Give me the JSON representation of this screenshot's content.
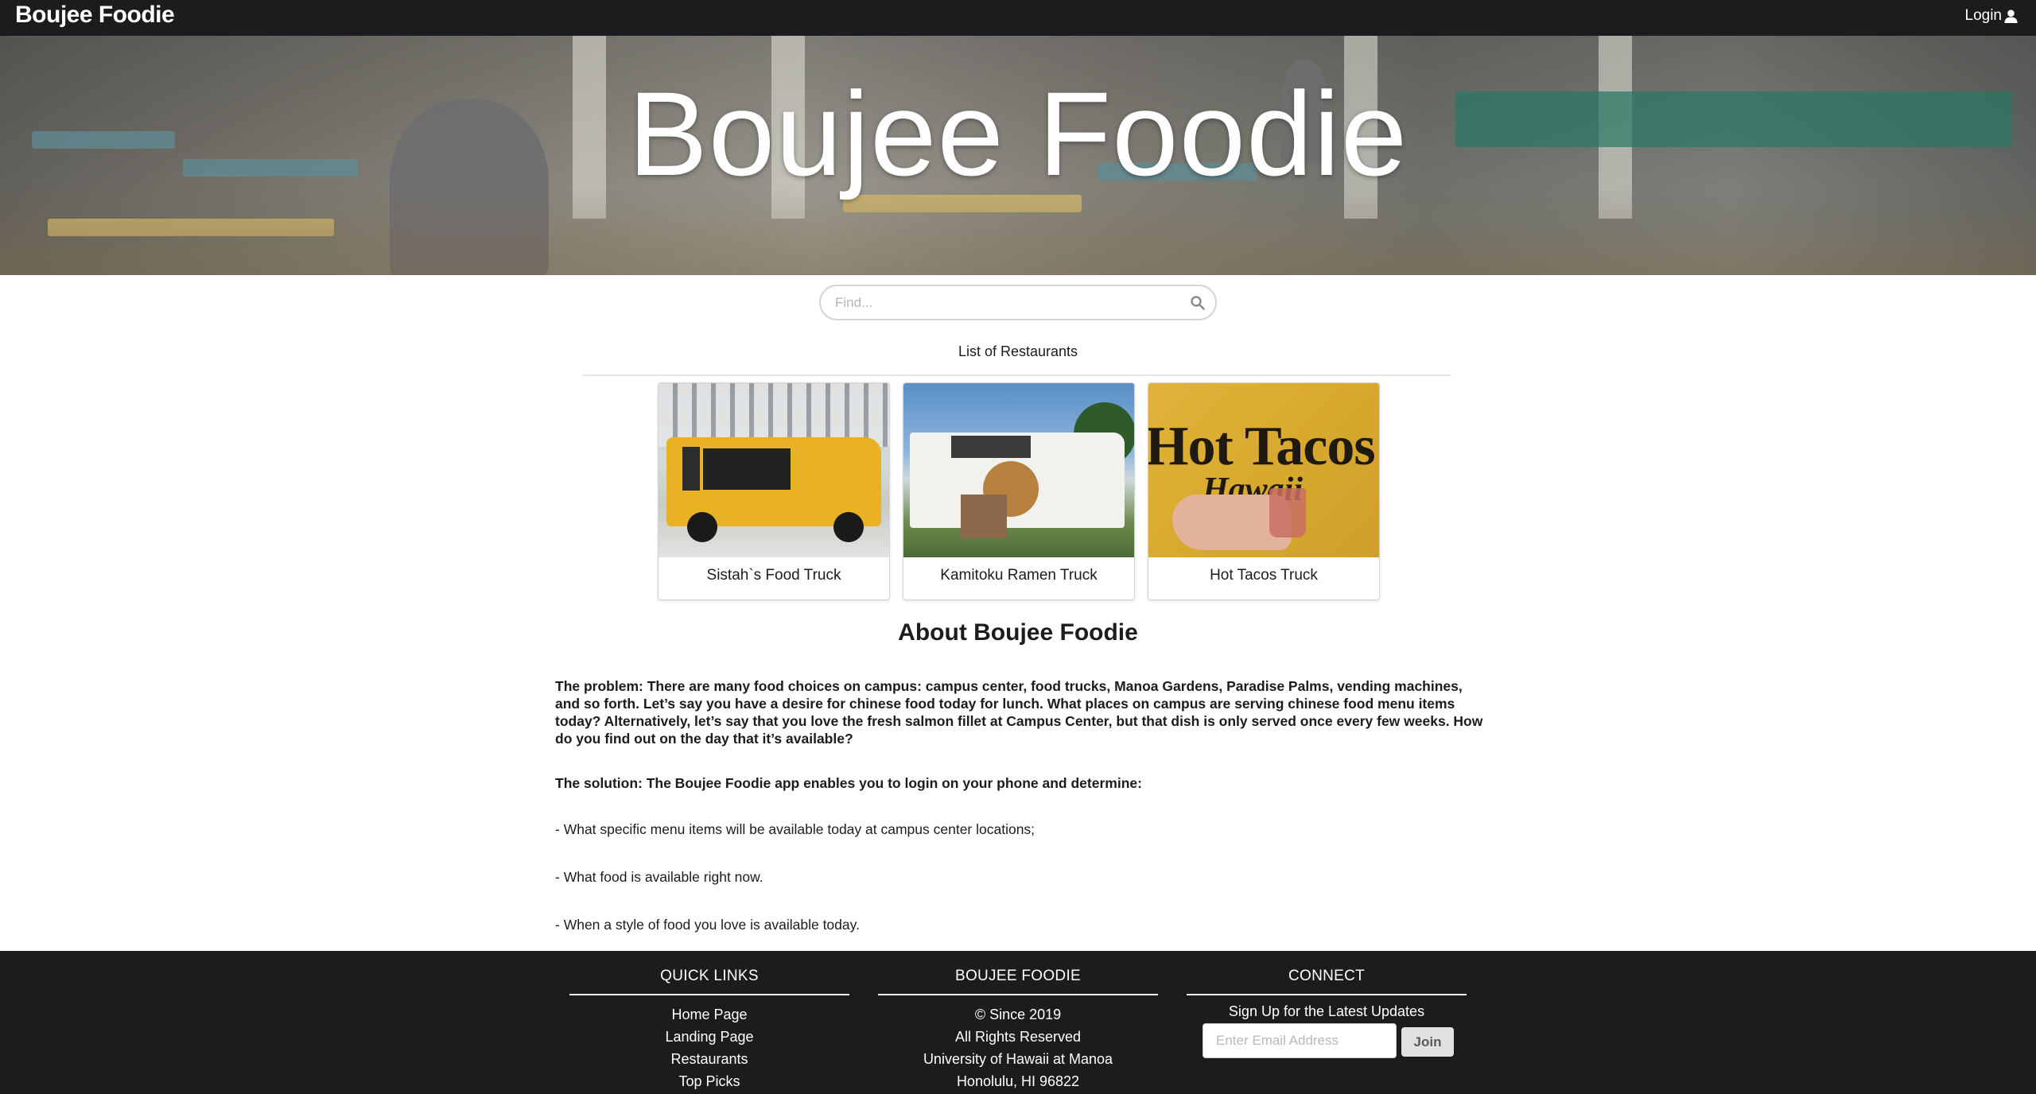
{
  "navbar": {
    "brand": "Boujee Foodie",
    "login_label": "Login",
    "login_icon": "user-icon"
  },
  "hero": {
    "title": "Boujee Foodie"
  },
  "search": {
    "placeholder": "Find...",
    "icon": "search-icon"
  },
  "restaurants": {
    "heading": "List of Restaurants",
    "items": [
      {
        "name": "Sistah`s Food Truck"
      },
      {
        "name": "Kamitoku Ramen Truck"
      },
      {
        "name": "Hot Tacos Truck"
      }
    ],
    "card3_sign": {
      "line1": "Hot Tacos",
      "line2": "Hawaii"
    }
  },
  "about": {
    "title": "About Boujee Foodie",
    "problem": "The problem: There are many food choices on campus: campus center, food trucks, Manoa Gardens, Paradise Palms, vending machines, and so forth. Let’s say you have a desire for chinese food today for lunch. What places on campus are serving chinese food menu items today? Alternatively, let’s say that you love the fresh salmon fillet at Campus Center, but that dish is only served once every few weeks. How do you find out on the day that it’s available?",
    "solution": "The solution: The Boujee Foodie app enables you to login on your phone and determine:",
    "bullets": [
      "- What specific menu items will be available today at campus center locations;",
      "- What food is available right now.",
      "- When a style of food you love is available today."
    ]
  },
  "footer": {
    "quick_links": {
      "title": "QUICK LINKS",
      "links": [
        "Home Page",
        "Landing Page",
        "Restaurants",
        "Top Picks"
      ]
    },
    "boujee": {
      "title": "BOUJEE FOODIE",
      "lines": [
        "© Since 2019",
        "All Rights Reserved",
        "University of Hawaii at Manoa",
        "Honolulu, HI 96822"
      ]
    },
    "connect": {
      "title": "CONNECT",
      "signup": "Sign Up for the Latest Updates",
      "email_placeholder": "Enter Email Address",
      "join_label": "Join"
    }
  }
}
